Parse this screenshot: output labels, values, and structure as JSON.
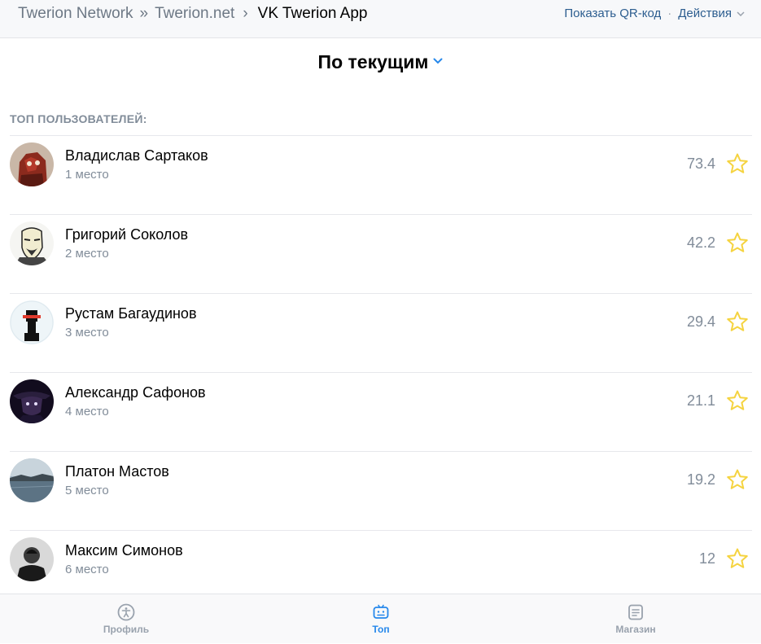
{
  "header": {
    "breadcrumb": [
      "Twerion Network",
      "Twerion.net",
      "VK Twerion App"
    ],
    "breadcrumb_sep": "»",
    "breadcrumb_chevron": "›",
    "actions": {
      "qr": "Показать QR-код",
      "dot": "·",
      "menu": "Действия"
    }
  },
  "filter": {
    "title": "По текущим"
  },
  "list": {
    "header": "ТОП ПОЛЬЗОВАТЕЛЕЙ:",
    "items": [
      {
        "name": "Владислав Сартаков",
        "place": "1 место",
        "score": "73.4"
      },
      {
        "name": "Григорий Соколов",
        "place": "2 место",
        "score": "42.2"
      },
      {
        "name": "Рустам Багаудинов",
        "place": "3 место",
        "score": "29.4"
      },
      {
        "name": "Александр Сафонов",
        "place": "4 место",
        "score": "21.1"
      },
      {
        "name": "Платон Мастов",
        "place": "5 место",
        "score": "19.2"
      },
      {
        "name": "Максим Симонов",
        "place": "6 место",
        "score": "12"
      }
    ]
  },
  "tabbar": {
    "tabs": [
      {
        "label": "Профиль",
        "icon": "accessibility-icon",
        "active": false
      },
      {
        "label": "Топ",
        "icon": "robot-icon",
        "active": true
      },
      {
        "label": "Магазин",
        "icon": "list-icon",
        "active": false
      }
    ]
  },
  "colors": {
    "accent": "#2688eb",
    "link": "#2c5d8f",
    "secondary": "#818c99",
    "star": "#f5d33f"
  }
}
